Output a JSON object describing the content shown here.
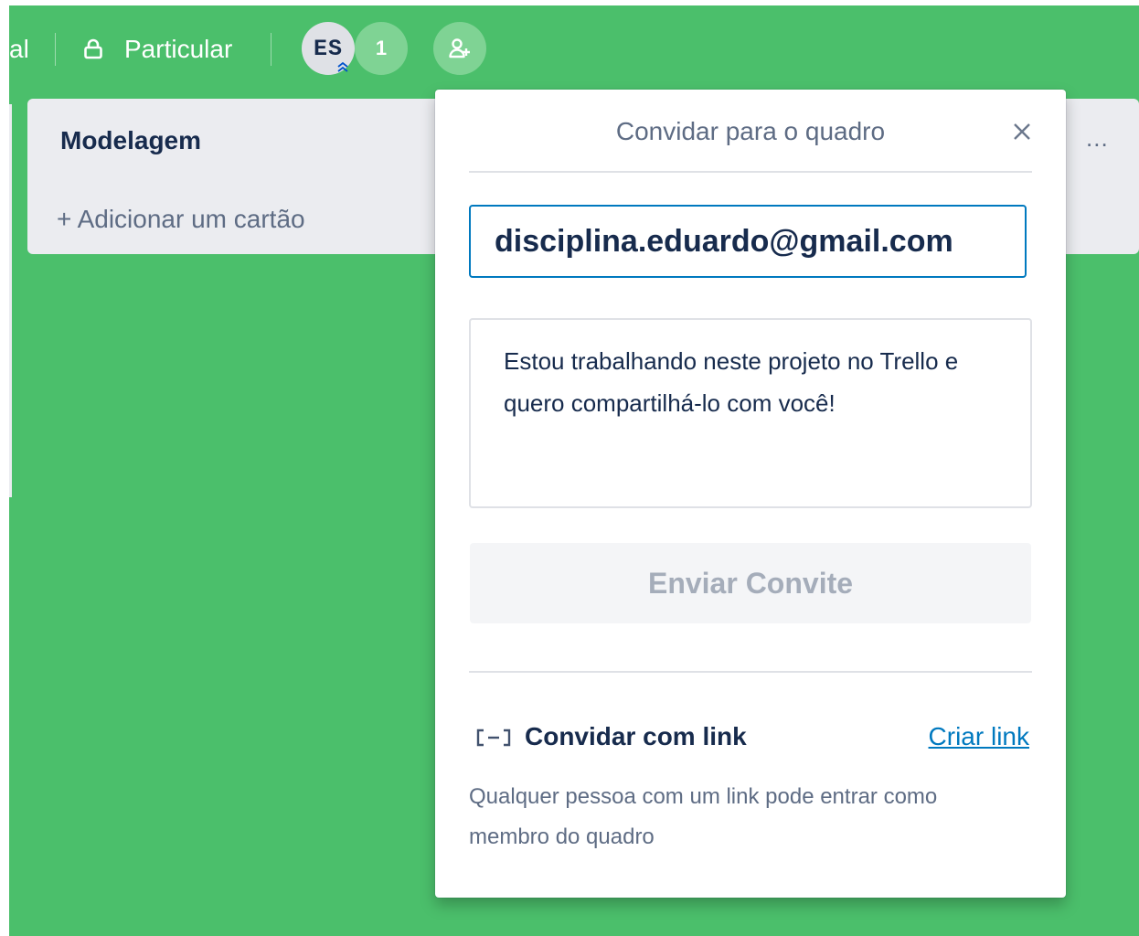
{
  "header": {
    "board_name_fragment": "al",
    "visibility_label": "Particular",
    "member_initials": "ES",
    "member_count": "1"
  },
  "list": {
    "title": "Modelagem",
    "add_card_label": "+ Adicionar um cartão",
    "menu_glyph": "..."
  },
  "popover": {
    "title": "Convidar para o quadro",
    "email_value": "disciplina.eduardo@gmail.com",
    "message_value": "Estou trabalhando neste projeto no Trello e quero compartilhá-lo com você!",
    "send_label": "Enviar Convite",
    "invite_link_title": "Convidar com link",
    "create_link_label": "Criar link",
    "invite_link_description": "Qualquer pessoa com um link pode entrar como membro do quadro"
  },
  "colors": {
    "board_bg": "#4bbf6b",
    "list_bg": "#ebecf0",
    "link_blue": "#0079bf",
    "input_focus_border": "#0079bf"
  },
  "icons": {
    "visibility": "lock-icon",
    "admin_badge": "double-chevron-up-icon",
    "invite": "add-member-icon",
    "close": "close-icon",
    "link": "link-bracket-icon",
    "list_menu": "ellipsis-icon"
  }
}
